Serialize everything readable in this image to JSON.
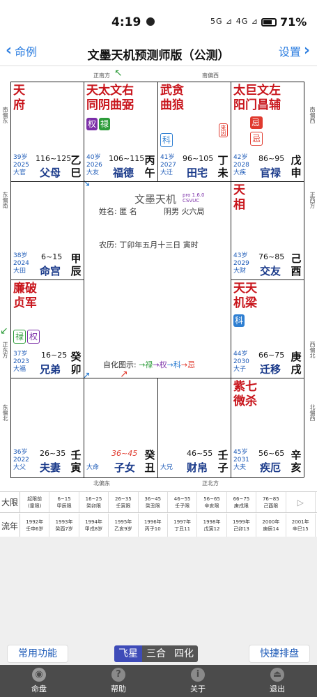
{
  "status": {
    "time": "4:19",
    "icons": "5G ⊿ 4G ⊿",
    "battery": "71%"
  },
  "nav": {
    "back": "命例",
    "title": "文墨天机预测师版（公测）",
    "settings": "设置"
  },
  "directions": {
    "top1": "正南方",
    "top2": "南偏西",
    "left1": "南偏东",
    "left2": "东偏南",
    "left3": "正东方",
    "left4": "东偏北",
    "right1": "南偏西",
    "right2": "正西方",
    "right3": "西偏北",
    "right4": "北偏西",
    "bottom1": "北偏东",
    "bottom2": "正北方"
  },
  "palaces": {
    "si": {
      "stars": [
        "天",
        "府"
      ],
      "age": "39岁",
      "year": "2025",
      "dx": "大官",
      "range": "116~125",
      "name": "父母",
      "gz1": "乙",
      "gz2": "巳"
    },
    "wu": {
      "stars": [
        "天太文右",
        "同阴曲弼"
      ],
      "badges": [
        "权",
        "禄"
      ],
      "age": "40岁",
      "year": "2026",
      "dx": "大友",
      "range": "106~115",
      "name": "福德",
      "gz1": "丙",
      "gz2": "午"
    },
    "wei": {
      "stars": [
        "武贪",
        "曲狼"
      ],
      "badges": [
        "科"
      ],
      "vbadge": "来因",
      "age": "41岁",
      "year": "2027",
      "dx": "大迁",
      "range": "96~105",
      "name": "田宅",
      "gz1": "丁",
      "gz2": "未"
    },
    "shen": {
      "stars": [
        "太巨文左",
        "阳门昌辅"
      ],
      "badges": [
        "忌",
        "忌"
      ],
      "age": "42岁",
      "year": "2028",
      "dx": "大疾",
      "range": "86~95",
      "name": "官禄",
      "gz1": "戊",
      "gz2": "申"
    },
    "chen": {
      "stars": [],
      "age": "38岁",
      "year": "2024",
      "dx": "大田",
      "range": "6~15",
      "name": "命宫",
      "gz1": "甲",
      "gz2": "辰"
    },
    "you": {
      "stars": [
        "天",
        "相"
      ],
      "age": "43岁",
      "year": "2029",
      "dx": "大财",
      "range": "76~85",
      "name": "交友",
      "gz1": "己",
      "gz2": "酉"
    },
    "mao": {
      "stars": [
        "廉破",
        "贞军"
      ],
      "badges": [
        "禄",
        "权"
      ],
      "age": "37岁",
      "year": "2023",
      "dx": "大福",
      "range": "16~25",
      "name": "兄弟",
      "gz1": "癸",
      "gz2": "卯"
    },
    "xu": {
      "stars": [
        "天天",
        "机梁"
      ],
      "badges": [
        "科"
      ],
      "age": "44岁",
      "year": "2030",
      "dx": "大子",
      "range": "66~75",
      "name": "迁移",
      "gz1": "庚",
      "gz2": "戌"
    },
    "yin": {
      "stars": [],
      "age": "36岁",
      "year": "2022",
      "dx": "大父",
      "range": "26~35",
      "name": "夫妻",
      "gz1": "壬",
      "gz2": "寅"
    },
    "chou": {
      "stars": [],
      "dx": "大命",
      "range": "36~45",
      "name": "子女",
      "gz1": "癸",
      "gz2": "丑"
    },
    "zi": {
      "stars": [],
      "dx": "大兄",
      "range": "46~55",
      "name": "财帛",
      "gz1": "壬",
      "gz2": "子"
    },
    "hai": {
      "stars": [
        "紫七",
        "微杀"
      ],
      "age": "45岁",
      "year": "2031",
      "dx": "大夫",
      "range": "56~65",
      "name": "疾厄",
      "gz1": "辛",
      "gz2": "亥"
    }
  },
  "center": {
    "title": "文墨天机",
    "pro": "pro 1.6.0",
    "pro2": "CSVUC",
    "name_line": "姓名: 匿 名",
    "yinyang": "阴男 火六局",
    "lunar": "农历: 丁卯年五月十三日 寅时",
    "legend_label": "自化图示:",
    "legend_lu": "→禄",
    "legend_quan": "→权",
    "legend_ke": "→科",
    "legend_ji": "→忌"
  },
  "daxian": {
    "row1_head": "大限",
    "row1": [
      [
        "起限前",
        "(童限)"
      ],
      [
        "6~15",
        "甲辰限"
      ],
      [
        "16~25",
        "癸卯限"
      ],
      [
        "26~35",
        "壬寅限"
      ],
      [
        "36~45",
        "癸丑限"
      ],
      [
        "46~55",
        "壬子限"
      ],
      [
        "56~65",
        "辛亥限"
      ],
      [
        "66~75",
        "庚戌限"
      ],
      [
        "76~85",
        "己酉限"
      ]
    ],
    "row1_arrow": "▷",
    "row2_head": "流年",
    "row2": [
      [
        "1992年",
        "壬申6岁"
      ],
      [
        "1993年",
        "癸酉7岁"
      ],
      [
        "1994年",
        "甲戌8岁"
      ],
      [
        "1995年",
        "乙亥9岁"
      ],
      [
        "1996年",
        "丙子10"
      ],
      [
        "1997年",
        "丁丑11"
      ],
      [
        "1998年",
        "戊寅12"
      ],
      [
        "1999年",
        "己卯13"
      ],
      [
        "2000年",
        "庚辰14"
      ],
      [
        "2001年",
        "辛巳15"
      ]
    ]
  },
  "buttons": {
    "common": "常用功能",
    "quick": "快捷排盘"
  },
  "segments": [
    "飞星",
    "三合",
    "四化"
  ],
  "tabs": [
    {
      "label": "命盘",
      "icon": "chart-disc-icon"
    },
    {
      "label": "帮助",
      "icon": "help-icon"
    },
    {
      "label": "关于",
      "icon": "info-icon"
    },
    {
      "label": "退出",
      "icon": "exit-icon"
    }
  ]
}
